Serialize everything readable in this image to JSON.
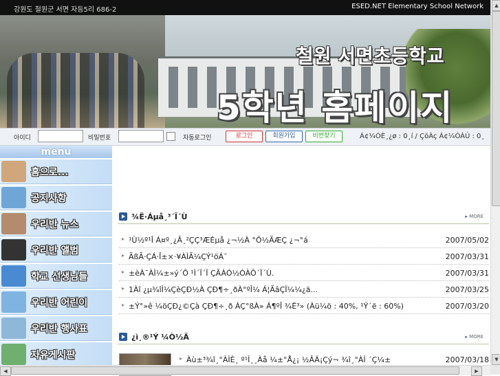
{
  "topbar": {
    "address": "강원도 철원군 서면 자등5리 686-2",
    "network": "ESED.NET Elementary School Network"
  },
  "banner": {
    "school_name": "철원 서면초등학교",
    "page_title": "5학년 홈페이지"
  },
  "login": {
    "id_label": "아이디",
    "pw_label": "비밀번호",
    "auto_login_label": "자동로그인",
    "login_button": "로그인",
    "join_button": "회원가입",
    "find_pw_button": "비번찾기",
    "status_text": "Á¢¼ÓÈ¸¿ø : 0¸í / ÇöÀç Á¢¼ÓÀÚ : 0¸"
  },
  "menu": {
    "header": "menu",
    "items": [
      {
        "label": "홈으로...",
        "icon": "home-icon",
        "color": "#cfa77a"
      },
      {
        "label": "공지사항",
        "icon": "notice-icon",
        "color": "#6fa6d8"
      },
      {
        "label": "우리반 뉴스",
        "icon": "news-icon",
        "color": "#b38b6d"
      },
      {
        "label": "우리반 앨범",
        "icon": "camera-icon",
        "color": "#333333"
      },
      {
        "label": "학교 선생님들",
        "icon": "teacher-icon",
        "color": "#4a8ad0"
      },
      {
        "label": "우리반 어린이",
        "icon": "children-icon",
        "color": "#7fb3e0"
      },
      {
        "label": "우리반 행사표",
        "icon": "calendar-icon",
        "color": "#8fb8d8"
      },
      {
        "label": "자유게시판",
        "icon": "board-icon",
        "color": "#6fb06f"
      }
    ]
  },
  "sections": {
    "notice": {
      "title": "¾Ë·Áµå¸³´Ï´Ù",
      "more": "MORE",
      "rows": [
        {
          "text": "¹Ù½º¹Î Á¤º¸¿Â¸²ÇÇ³ÆÈµå ¿¬½À °Ô½ÃÆÇ ¿¬°á",
          "date": "2007/05/02"
        },
        {
          "text": "ÃßÃ·ÇÁ·Î±×·¥ÀÌÃ¼ÇÝ¹öÁ¯",
          "date": "2007/03/31"
        },
        {
          "text": "±èÀ¯ÀÌ¼±»ý´Ô ¹Ì´Ï´Ï ÇÃÀÓ½ÓÀÔ´Ï´Ù.",
          "date": "2007/03/31"
        },
        {
          "text": "1Àî ¿µ¾îÌ¼ÇèÇÐ½À ÇÐ¶÷¸ðÀ°ºÎ¼ Á¦ÃâÇÏ¼¼¿ä...",
          "date": "2007/03/25"
        },
        {
          "text": "±Ý°»ê ¼öÇÐ¿©Çà ÇÐ¶÷¸ð ÀÇ°ßÀ» Á¶ºÎ ¾Ë³» (Àü¼ö : 40%, ¹Ý´ë : 60%)",
          "date": "2007/03/20"
        }
      ]
    },
    "news": {
      "title": "¿ì¸®¹Ý ¼Ò½Ä",
      "more": "MORE",
      "rows": [
        {
          "text": "Àù±³¾î¸°ÀÌÈ¸ º¹Ì¸¸Àå ¼±°Å¿¡ ½ÂÄ¡Çý¬ ¾î¸°ÀÌ ´Ç¼±",
          "date": "2007/03/18"
        }
      ]
    }
  }
}
